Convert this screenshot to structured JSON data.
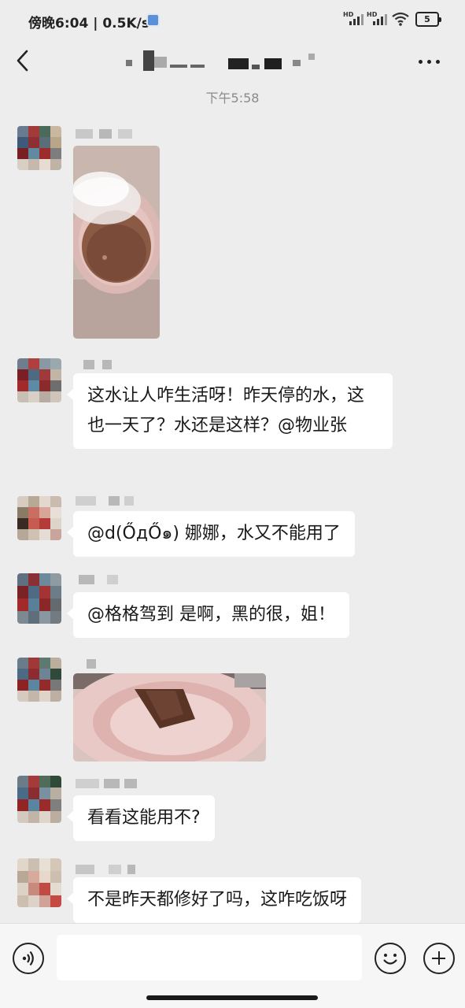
{
  "status_bar": {
    "time_label": "傍晚6:04 | 0.5K/s",
    "battery_label": "5",
    "hd_label": "HD"
  },
  "nav": {
    "back_icon": "chevron-left-icon",
    "more_icon": "more-icon"
  },
  "timestamp": "下午5:58",
  "messages": [
    {
      "type": "image",
      "image": "pink-bowl-brown-water-photo"
    },
    {
      "type": "text",
      "text": "这水让人咋生活呀！昨天停的水，这也一天了？水还是这样？@物业张"
    },
    {
      "type": "text",
      "text": "@d(ŐдŐ๑) 娜娜，水又不能用了"
    },
    {
      "type": "text",
      "text": "@格格驾到  是啊，黑的很，姐！"
    },
    {
      "type": "image",
      "image": "pink-basin-dark-water-photo"
    },
    {
      "type": "text",
      "text": "看看这能用不?"
    },
    {
      "type": "text",
      "text": "不是昨天都修好了吗，这咋吃饭呀"
    }
  ],
  "input_bar": {
    "voice_icon": "voice-icon",
    "emoji_icon": "emoji-icon",
    "plus_icon": "plus-icon",
    "input_value": ""
  },
  "colors": {
    "background": "#ededed",
    "bubble": "#ffffff",
    "timestamp": "#8a8a8a"
  }
}
